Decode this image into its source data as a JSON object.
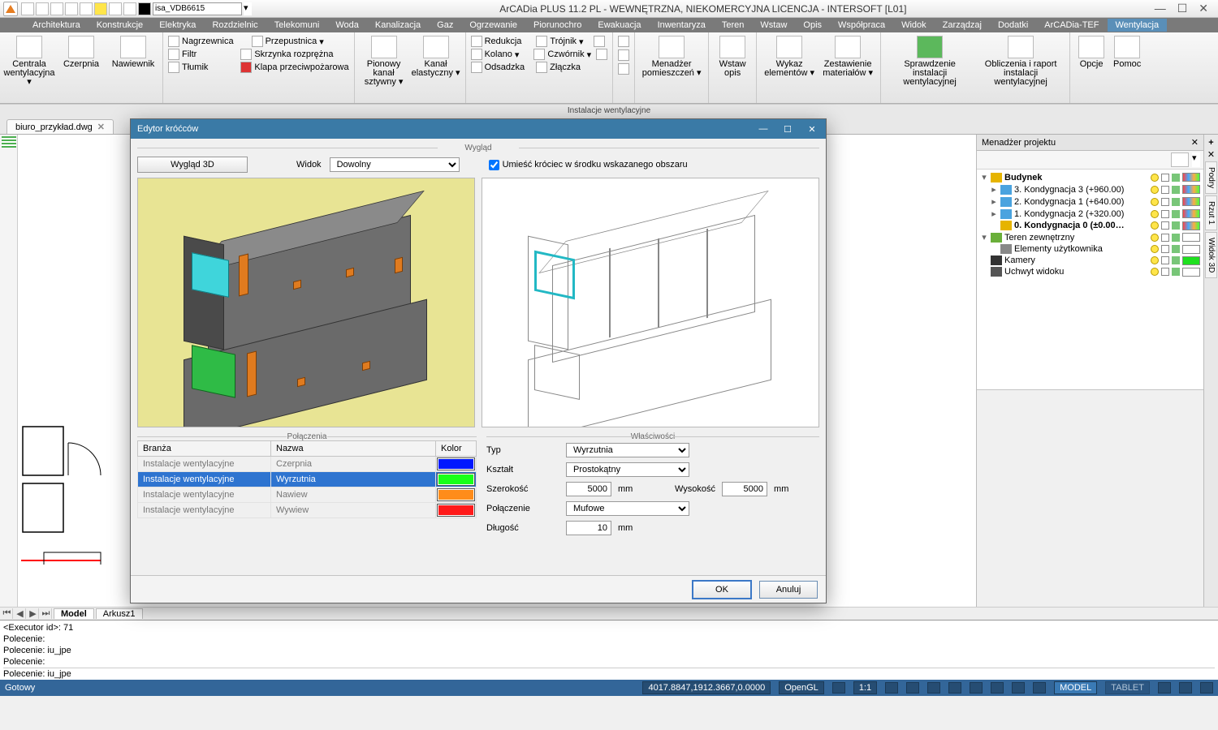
{
  "app": {
    "title": "ArCADia PLUS 11.2 PL - WEWNĘTRZNA, NIEKOMERCYJNA LICENCJA - INTERSOFT [L01]",
    "qat_selector": "isa_VDB6615"
  },
  "menu": {
    "items": [
      "Architektura",
      "Konstrukcje",
      "Elektryka",
      "Rozdzielnic",
      "Telekomuni",
      "Woda",
      "Kanalizacja",
      "Gaz",
      "Ogrzewanie",
      "Piorunochro",
      "Ewakuacja",
      "Inwentaryza",
      "Teren",
      "Wstaw",
      "Opis",
      "Współpraca",
      "Widok",
      "Zarządzaj",
      "Dodatki",
      "ArCADia-TEF",
      "Wentylacja"
    ],
    "active": "Wentylacja"
  },
  "ribbon": {
    "panel_title": "Instalacje wentylacyjne",
    "g1": {
      "a": "Centrala\nwentylacyjna ▾",
      "b": "Czerpnia",
      "c": "Nawiewnik"
    },
    "g2": {
      "a": "Nagrzewnica",
      "b": "Filtr",
      "c": "Tłumik",
      "d": "Przepustnica",
      "e": "Skrzynka rozprężna",
      "f": "Klapa przeciwpożarowa"
    },
    "g3": {
      "a": "Pionowy kanał\nsztywny ▾",
      "b": "Kanał\nelastyczny ▾"
    },
    "g4": {
      "a": "Redukcja",
      "b": "Kolano",
      "c": "Odsadzka",
      "d": "Trójnik",
      "e": "Czwórnik",
      "f": "Złączka"
    },
    "g5": {
      "a": "Menadżer\npomieszczeń ▾"
    },
    "g6": {
      "a": "Wstaw\nopis"
    },
    "g7": {
      "a": "Wykaz\nelementów ▾",
      "b": "Zestawienie\nmateriałów ▾"
    },
    "g8": {
      "a": "Sprawdzenie instalacji\nwentylacyjnej",
      "b": "Obliczenia i raport\ninstalacji wentylacyjnej"
    },
    "g9": {
      "a": "Opcje",
      "b": "Pomoc"
    }
  },
  "doc_tab": {
    "name": "biuro_przykład.dwg"
  },
  "sheet_tabs": {
    "model": "Model",
    "sheet": "Arkusz1"
  },
  "pm": {
    "title": "Menadżer projektu",
    "nodes": [
      {
        "level": 0,
        "exp": "▾",
        "icon": "building",
        "text": "Budynek",
        "bold": true,
        "sw": "multi"
      },
      {
        "level": 1,
        "exp": "▸",
        "icon": "floor",
        "text": "3. Kondygnacja 3 (+960.00)",
        "sw": "multi"
      },
      {
        "level": 1,
        "exp": "▸",
        "icon": "floor",
        "text": "2. Kondygnacja 1 (+640.00)",
        "sw": "multi"
      },
      {
        "level": 1,
        "exp": "▸",
        "icon": "floor",
        "text": "1. Kondygnacja 2 (+320.00)",
        "sw": "multi"
      },
      {
        "level": 1,
        "exp": "",
        "icon": "floor-active",
        "text": "0. Kondygnacja 0 (±0.00…",
        "bold": true,
        "sw": "multi"
      },
      {
        "level": 0,
        "exp": "▾",
        "icon": "terrain",
        "text": "Teren zewnętrzny",
        "sw": "white"
      },
      {
        "level": 1,
        "exp": "",
        "icon": "user",
        "text": "Elementy użytkownika",
        "sw": "white"
      },
      {
        "level": 0,
        "exp": "",
        "icon": "camera",
        "text": "Kamery",
        "sw": "green"
      },
      {
        "level": 0,
        "exp": "",
        "icon": "grip",
        "text": "Uchwyt widoku",
        "sw": "white"
      }
    ]
  },
  "sidetabs": [
    "Podry",
    "Rzut 1",
    "Widok 3D"
  ],
  "cmd": {
    "lines": [
      "<Executor id>: 71",
      "Polecenie:",
      "Polecenie: iu_jpe",
      "Polecenie:"
    ],
    "current": "Polecenie: iu_jpe"
  },
  "status": {
    "ready": "Gotowy",
    "coords": "4017.8847,1912.3667,0.0000",
    "gl": "OpenGL",
    "scale": "1:1",
    "model": "MODEL",
    "tablet": "TABLET"
  },
  "dialog": {
    "title": "Edytor króćców",
    "section_appearance": "Wygląd",
    "btn_3d": "Wygląd 3D",
    "lbl_view": "Widok",
    "view_value": "Dowolny",
    "chk_place": "Umieść króciec w środku wskazanego obszaru",
    "section_connections": "Połączenia",
    "section_properties": "Właściwości",
    "cols": {
      "branza": "Branża",
      "nazwa": "Nazwa",
      "kolor": "Kolor"
    },
    "rows": [
      {
        "b": "Instalacje wentylacyjne",
        "n": "Czerpnia",
        "c": "#0018ff"
      },
      {
        "b": "Instalacje wentylacyjne",
        "n": "Wyrzutnia",
        "c": "#18ff18",
        "sel": true
      },
      {
        "b": "Instalacje wentylacyjne",
        "n": "Nawiew",
        "c": "#ff8c1a"
      },
      {
        "b": "Instalacje wentylacyjne",
        "n": "Wywiew",
        "c": "#ff1a1a"
      }
    ],
    "props": {
      "typ_l": "Typ",
      "typ_v": "Wyrzutnia",
      "ksztalt_l": "Kształt",
      "ksztalt_v": "Prostokątny",
      "szer_l": "Szerokość",
      "szer_v": "5000",
      "szer_u": "mm",
      "wys_l": "Wysokość",
      "wys_v": "5000",
      "wys_u": "mm",
      "pol_l": "Połączenie",
      "pol_v": "Mufowe",
      "dlug_l": "Długość",
      "dlug_v": "10",
      "dlug_u": "mm"
    },
    "ok": "OK",
    "cancel": "Anuluj"
  }
}
